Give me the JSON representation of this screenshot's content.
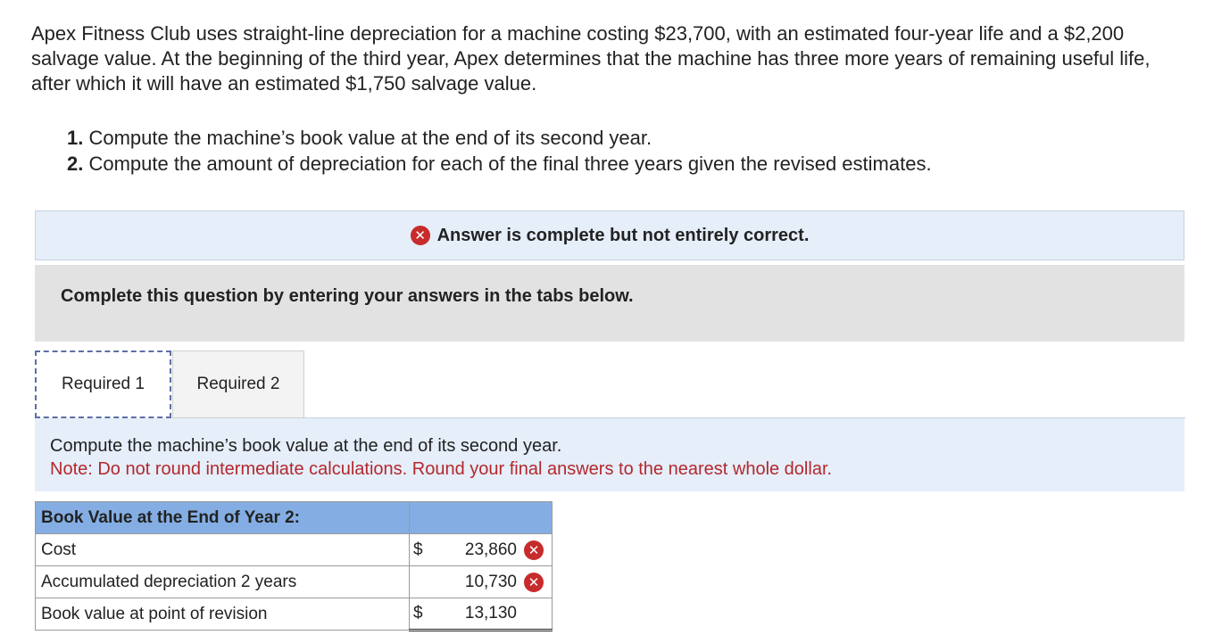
{
  "problem": {
    "text": "Apex Fitness Club uses straight-line depreciation for a machine costing $23,700, with an estimated four-year life and a $2,200 salvage value. At the beginning of the third year, Apex determines that the machine has three more years of remaining useful life, after which it will have an estimated $1,750 salvage value."
  },
  "requirements": [
    {
      "num": "1.",
      "text": " Compute the machine’s book value at the end of its second year."
    },
    {
      "num": "2.",
      "text": " Compute the amount of depreciation for each of the final three years given the revised estimates."
    }
  ],
  "status": {
    "icon": "x-circle-icon",
    "text": "Answer is complete but not entirely correct.",
    "color": "#c72b2b"
  },
  "instructions": "Complete this question by entering your answers in the tabs below.",
  "tabs": [
    {
      "label": "Required 1",
      "active": true
    },
    {
      "label": "Required 2",
      "active": false
    }
  ],
  "panel": {
    "prompt": "Compute the machine’s book value at the end of its second year.",
    "note": "Note: Do not round intermediate calculations. Round your final answers to the nearest whole dollar."
  },
  "table": {
    "header": "Book Value at the End of Year 2:",
    "rows": [
      {
        "label": "Cost",
        "currency": "$",
        "value": "23,860",
        "mark": "incorrect"
      },
      {
        "label": "Accumulated depreciation 2 years",
        "currency": "",
        "value": "10,730",
        "mark": "incorrect"
      },
      {
        "label": "Book value at point of revision",
        "currency": "$",
        "value": "13,130",
        "mark": ""
      }
    ]
  },
  "colors": {
    "header_bg": "#84aee3",
    "panel_bg": "#e5eef9",
    "note_text": "#b3282d",
    "incorrect": "#c72b2b"
  }
}
